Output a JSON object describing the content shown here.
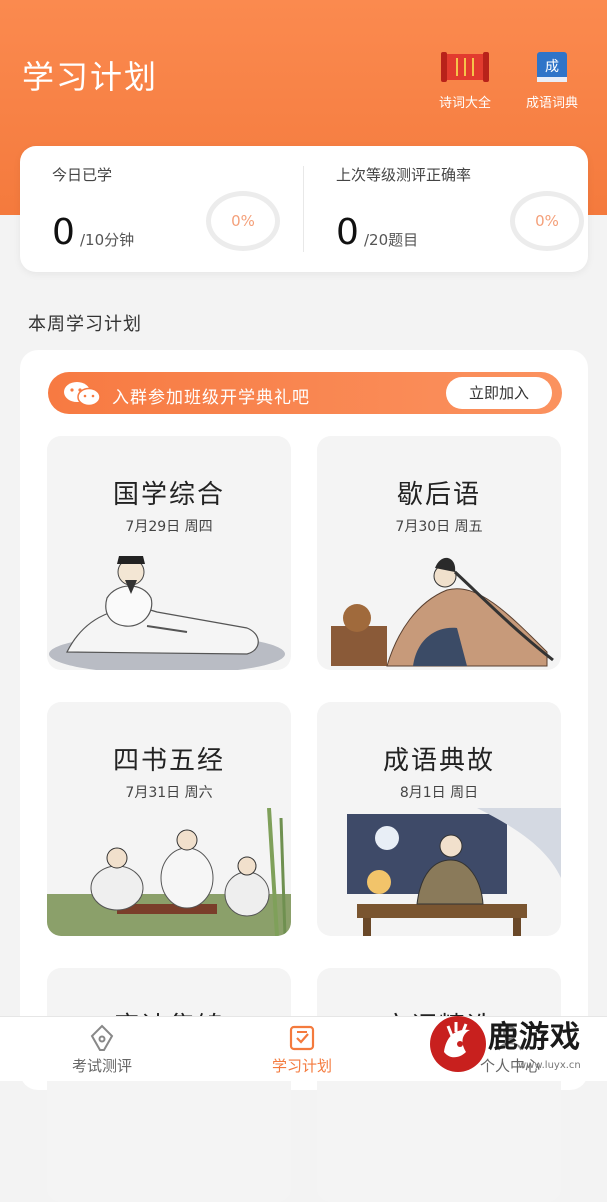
{
  "header": {
    "title": "学习计划",
    "actions": [
      {
        "label": "诗词大全",
        "icon": "scroll-icon"
      },
      {
        "label": "成语词典",
        "icon": "book-icon",
        "badge": "成"
      }
    ]
  },
  "stats": {
    "today": {
      "label": "今日已学",
      "value": "0",
      "unit": "/10分钟",
      "percent": "0%"
    },
    "last_test": {
      "label": "上次等级测评正确率",
      "value": "0",
      "unit": "/20题目",
      "percent": "0%"
    }
  },
  "section_title": "本周学习计划",
  "banner": {
    "text": "入群参加班级开学典礼吧",
    "button": "立即加入"
  },
  "courses": [
    {
      "name": "国学综合",
      "date": "7月29日 周四"
    },
    {
      "name": "歇后语",
      "date": "7月30日 周五"
    },
    {
      "name": "四书五经",
      "date": "7月31日 周六"
    },
    {
      "name": "成语典故",
      "date": "8月1日 周日"
    },
    {
      "name": "唐诗集锦",
      "date": ""
    },
    {
      "name": "宋词精选",
      "date": ""
    }
  ],
  "tabs": [
    {
      "label": "考试测评"
    },
    {
      "label": "学习计划"
    },
    {
      "label": "个人中心"
    }
  ],
  "watermark": {
    "text": "鹿游戏",
    "url": "www.luyx.cn"
  },
  "colors": {
    "accent": "#f47a3d",
    "header": "#fb8a4f",
    "ring": "#ececec"
  }
}
